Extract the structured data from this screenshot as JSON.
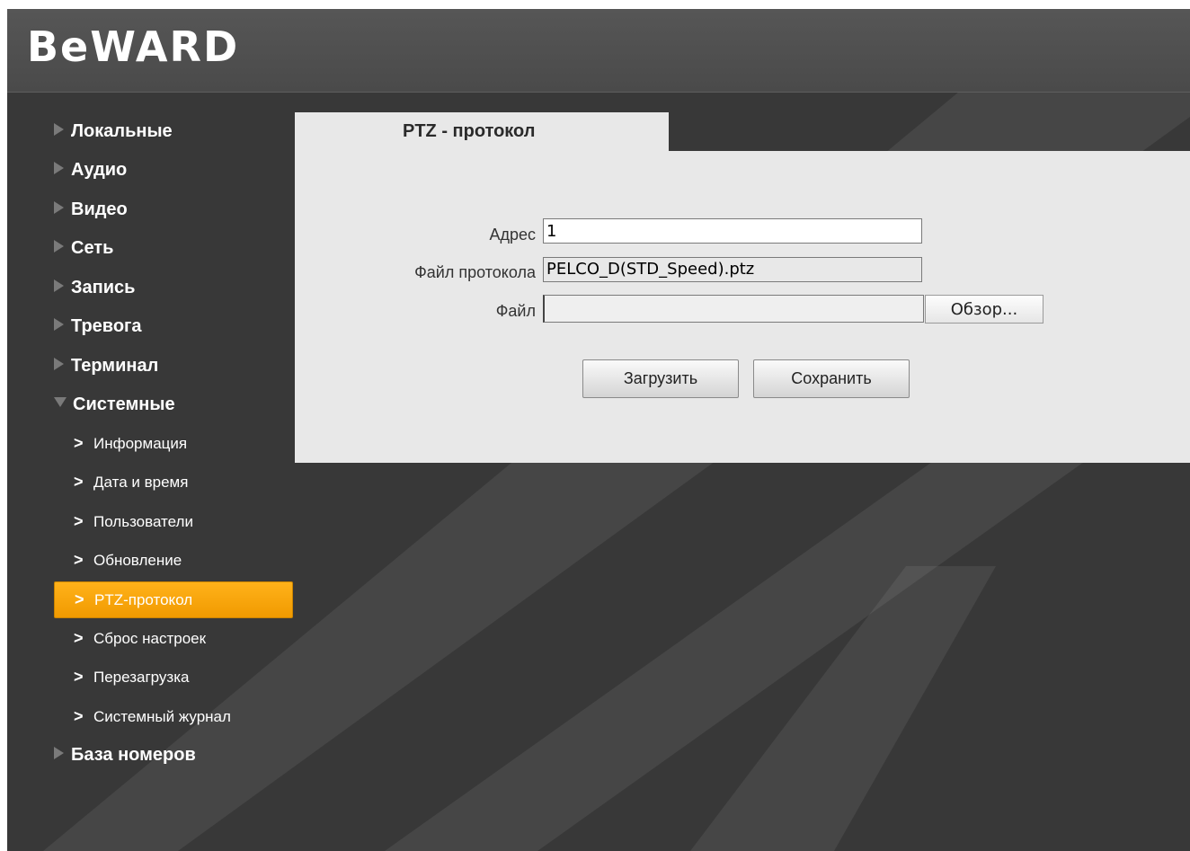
{
  "header": {
    "logo_text": "BeWARD"
  },
  "sidebar": {
    "items": [
      {
        "label": "Локальные"
      },
      {
        "label": "Аудио"
      },
      {
        "label": "Видео"
      },
      {
        "label": "Сеть"
      },
      {
        "label": "Запись"
      },
      {
        "label": "Тревога"
      },
      {
        "label": "Терминал"
      },
      {
        "label": "Системные",
        "expanded": true
      }
    ],
    "sub_items": [
      {
        "label": "Информация"
      },
      {
        "label": "Дата и время"
      },
      {
        "label": "Пользователи"
      },
      {
        "label": "Обновление"
      },
      {
        "label": "PTZ-протокол",
        "active": true
      },
      {
        "label": "Сброс настроек"
      },
      {
        "label": "Перезагрузка"
      },
      {
        "label": "Системный журнал"
      }
    ],
    "last_item": {
      "label": "База номеров"
    }
  },
  "content": {
    "tab_title": "PTZ - протокол",
    "address": {
      "label": "Адрес",
      "value": "1"
    },
    "protocol_file": {
      "label": "Файл протокола",
      "value": "PELCO_D(STD_Speed).ptz"
    },
    "file": {
      "label": "Файл",
      "value": "",
      "browse_label": "Обзор..."
    },
    "upload_label": "Загрузить",
    "save_label": "Сохранить"
  },
  "colors": {
    "accent": "#f5a000",
    "background": "#383838",
    "header": "#4e4e4e",
    "panel": "#e8e8e8"
  },
  "icons": {
    "collapsed": "triangle-right-icon",
    "expanded": "triangle-down-icon",
    "sub_item": "chevron-right-icon"
  }
}
